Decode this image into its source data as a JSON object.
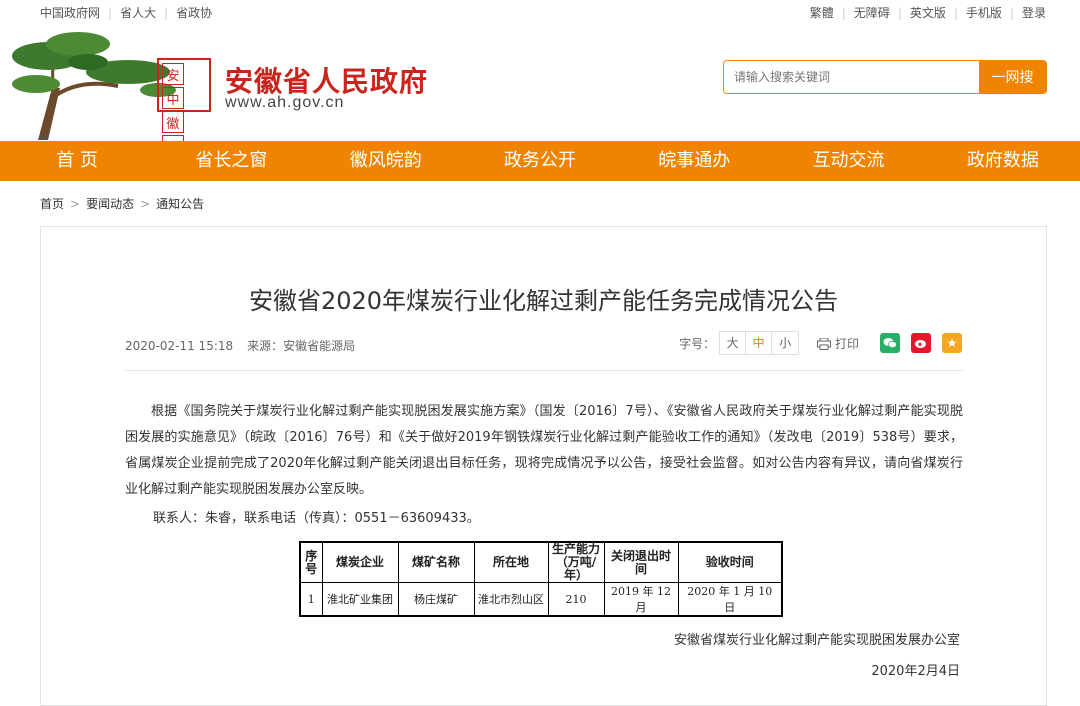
{
  "topbar": {
    "left_links": [
      "中国政府网",
      "省人大",
      "省政协"
    ],
    "right_links": [
      "繁體",
      "无障碍",
      "英文版",
      "手机版",
      "登录"
    ]
  },
  "header": {
    "seal_chars": [
      "安",
      "中",
      "徽",
      "国"
    ],
    "site_name": "安徽省人民政府",
    "site_url": "www.ah.gov.cn"
  },
  "search": {
    "placeholder": "请输入搜索关键词",
    "button": "一网搜"
  },
  "nav": [
    "首 页",
    "省长之窗",
    "徽风皖韵",
    "政务公开",
    "皖事通办",
    "互动交流",
    "政府数据"
  ],
  "breadcrumb": [
    "首页",
    "要闻动态",
    "通知公告"
  ],
  "article": {
    "title": "安徽省2020年煤炭行业化解过剩产能任务完成情况公告",
    "date": "2020-02-11 15:18",
    "source": "来源：安徽省能源局",
    "font_label": "字号：",
    "font_sizes": [
      "大",
      "中",
      "小"
    ],
    "print": "打印",
    "body": "根据《国务院关于煤炭行业化解过剩产能实现脱困发展实施方案》（国发〔2016〕7号）、《安徽省人民政府关于煤炭行业化解过剩产能实现脱困发展的实施意见》（皖政〔2016〕76号）和《关于做好2019年钢铁煤炭行业化解过剩产能验收工作的通知》（发改电〔2019〕538号）要求，省属煤炭企业提前完成了2020年化解过剩产能关闭退出目标任务，现将完成情况予以公告，接受社会监督。如对公告内容有异议，请向省煤炭行业化解过剩产能实现脱困发展办公室反映。",
    "contact": "联系人：朱睿，联系电话（传真）：0551－63609433。",
    "table": {
      "headers": [
        "序号",
        "煤炭企业",
        "煤矿名称",
        "所在地",
        "生产能力（万吨/年）",
        "关闭退出时　间",
        "验收时间"
      ],
      "rows": [
        [
          "1",
          "淮北矿业集团",
          "杨庄煤矿",
          "淮北市烈山区",
          "210",
          "2019 年 12 月",
          "2020 年 1 月 10 日"
        ]
      ]
    },
    "signature": "安徽省煤炭行业化解过剩产能实现脱困发展办公室",
    "sign_date": "2020年2月4日"
  },
  "colors": {
    "brand_orange": "#f08300",
    "brand_red": "#c9251d",
    "wechat": "#2aae67",
    "weibo": "#e6162d",
    "favorite": "#f5a623"
  },
  "icons": [
    "print-icon",
    "wechat-icon",
    "weibo-icon",
    "favorite-icon",
    "tree-logo-icon"
  ]
}
